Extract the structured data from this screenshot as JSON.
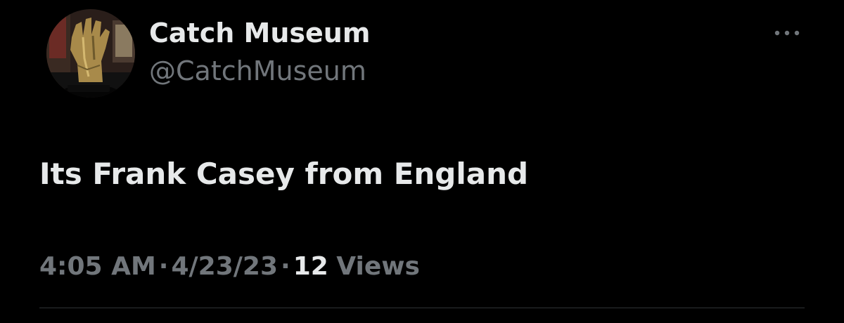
{
  "author": {
    "display_name": "Catch Museum",
    "handle": "@CatchMuseum",
    "avatar_icon": "bronze-hand-sculpture-avatar"
  },
  "tweet": {
    "text": "Its Frank Casey from England",
    "time": "4:05 AM",
    "separator": "·",
    "date": "4/23/23",
    "views_count": "12",
    "views_label": "Views"
  },
  "icons": {
    "more": "more-horizontal-icon"
  },
  "colors": {
    "background": "#000000",
    "primary_text": "#e7e9ea",
    "secondary_text": "#71767b",
    "divider": "#2f3336"
  }
}
